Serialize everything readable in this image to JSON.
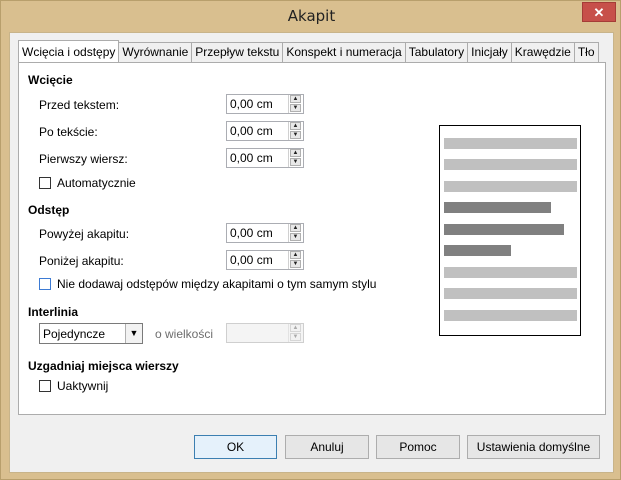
{
  "window": {
    "title": "Akapit",
    "close_glyph": "✕"
  },
  "tabs": [
    {
      "label": "Wcięcia i odstępy",
      "active": true
    },
    {
      "label": "Wyrównanie"
    },
    {
      "label": "Przepływ tekstu"
    },
    {
      "label": "Konspekt i numeracja"
    },
    {
      "label": "Tabulatory"
    },
    {
      "label": "Inicjały"
    },
    {
      "label": "Krawędzie"
    },
    {
      "label": "Tło"
    }
  ],
  "indent": {
    "heading": "Wcięcie",
    "before_label": "Przed tekstem:",
    "before_value": "0,00 cm",
    "after_label": "Po tekście:",
    "after_value": "0,00 cm",
    "first_label": "Pierwszy wiersz:",
    "first_value": "0,00 cm",
    "auto_label": "Automatycznie",
    "auto_checked": false
  },
  "spacing": {
    "heading": "Odstęp",
    "above_label": "Powyżej akapitu:",
    "above_value": "0,00 cm",
    "below_label": "Poniżej akapitu:",
    "below_value": "0,00 cm",
    "no_space_label": "Nie dodawaj odstępów między akapitami o tym samym stylu",
    "no_space_checked": false
  },
  "line_spacing": {
    "heading": "Interlinia",
    "selected": "Pojedyncze",
    "of_label": "o wielkości",
    "of_value": ""
  },
  "register": {
    "heading": "Uzgadniaj miejsca wierszy",
    "activate_label": "Uaktywnij",
    "activate_checked": false
  },
  "buttons": {
    "ok": "OK",
    "cancel": "Anuluj",
    "help": "Pomoc",
    "reset": "Ustawienia domyślne"
  },
  "colors": {
    "preview_light": "#c0c0c0",
    "preview_dark": "#808080"
  }
}
